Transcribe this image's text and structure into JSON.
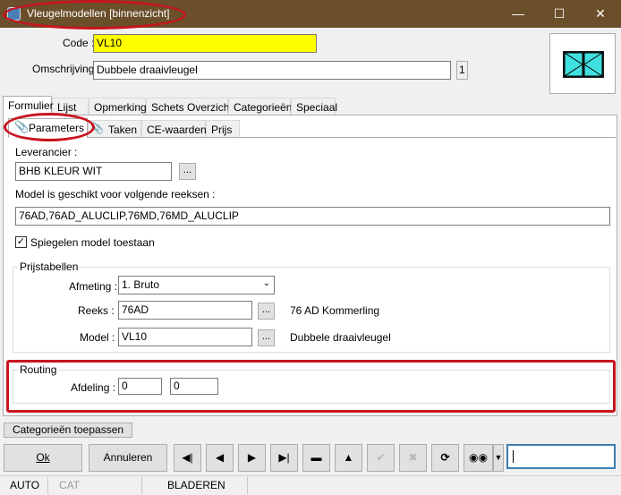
{
  "window": {
    "title": "Vleugelmodellen [binnenzicht]",
    "minimize": "—",
    "maximize": "☐",
    "close": "✕"
  },
  "header": {
    "code_label": "Code :",
    "code_value": "VL10",
    "code_color": "#ffff00",
    "description_label": "Omschrijving :",
    "description_value": "Dubbele draaivleugel",
    "description_count": "1"
  },
  "main_tabs": [
    "Formulier",
    "Lijst",
    "Opmerking",
    "Schets Overzicht",
    "Categorieën",
    "Speciaal"
  ],
  "sub_tabs": [
    "Parameters",
    "Taken",
    "CE-waarden",
    "Prijs"
  ],
  "form": {
    "supplier_label": "Leverancier :",
    "supplier_value": "BHB KLEUR  WIT",
    "series_label": "Model is geschikt voor volgende reeksen :",
    "series_value": "76AD,76AD_ALUCLIP,76MD,76MD_ALUCLIP",
    "mirror_label": "Spiegelen model toestaan",
    "mirror_checked": true
  },
  "pricing": {
    "group_label": "Prijstabellen",
    "size_label": "Afmeting :",
    "size_value": "1.  Bruto",
    "series_label": "Reeks :",
    "series_value": "76AD",
    "series_desc": "76 AD Kommerling",
    "model_label": "Model :",
    "model_value": "VL10",
    "model_desc": "Dubbele draaivleugel"
  },
  "routing": {
    "group_label": "Routing",
    "department_label": "Afdeling :",
    "department_value_1": "0",
    "department_value_2": "0"
  },
  "buttons": {
    "apply_categories": "Categorieën toepassen",
    "ok": "Ok",
    "cancel": "Annuleren",
    "dots": "..."
  },
  "nav_icons": [
    "first-icon",
    "prev-icon",
    "next-icon",
    "last-icon",
    "delete-icon",
    "insert-icon",
    "confirm-icon",
    "cancel-edit-icon",
    "refresh-icon",
    "binoculars-icon"
  ],
  "status": {
    "auto": "AUTO",
    "cat": "CAT",
    "mode": "BLADEREN"
  },
  "colors": {
    "titlebar": "#6b4f2a",
    "highlight": "#c8141e",
    "window_preview": "#40e0e0"
  }
}
